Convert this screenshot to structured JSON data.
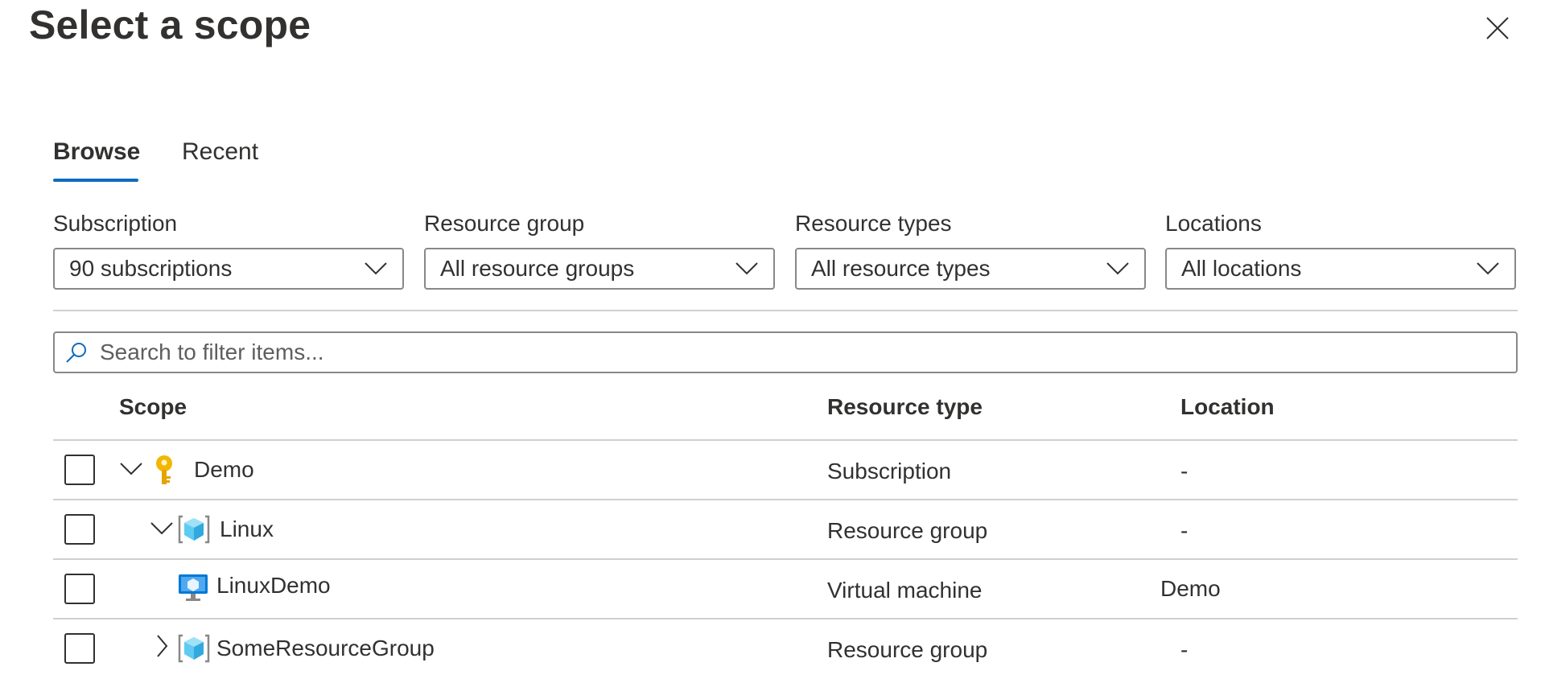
{
  "dialog": {
    "title": "Select a scope",
    "close_label": "Close"
  },
  "tabs": [
    {
      "label": "Browse",
      "active": true
    },
    {
      "label": "Recent",
      "active": false
    }
  ],
  "filters": {
    "subscription": {
      "label": "Subscription",
      "value": "90 subscriptions"
    },
    "resource_group": {
      "label": "Resource group",
      "value": "All resource groups"
    },
    "resource_types": {
      "label": "Resource types",
      "value": "All resource types"
    },
    "locations": {
      "label": "Locations",
      "value": "All locations"
    }
  },
  "search": {
    "placeholder": "Search to filter items..."
  },
  "table": {
    "columns": {
      "scope": "Scope",
      "resource_type": "Resource type",
      "location": "Location"
    },
    "rows": [
      {
        "name": "Demo",
        "resource_type": "Subscription",
        "location": "-",
        "icon": "subscription-key-icon",
        "expander": "expanded",
        "checked": false
      },
      {
        "name": "Linux",
        "resource_type": "Resource group",
        "location": "-",
        "icon": "resource-group-icon",
        "expander": "expanded",
        "checked": false
      },
      {
        "name": "LinuxDemo",
        "resource_type": "Virtual machine",
        "location": "Demo",
        "icon": "virtual-machine-icon",
        "expander": "none",
        "checked": false
      },
      {
        "name": "SomeResourceGroup",
        "resource_type": "Resource group",
        "location": "-",
        "icon": "resource-group-icon",
        "expander": "collapsed",
        "checked": false
      }
    ]
  },
  "colors": {
    "accent": "#0f6cbd",
    "text": "#323130",
    "border": "#8a8886",
    "divider": "#d2d0ce"
  }
}
